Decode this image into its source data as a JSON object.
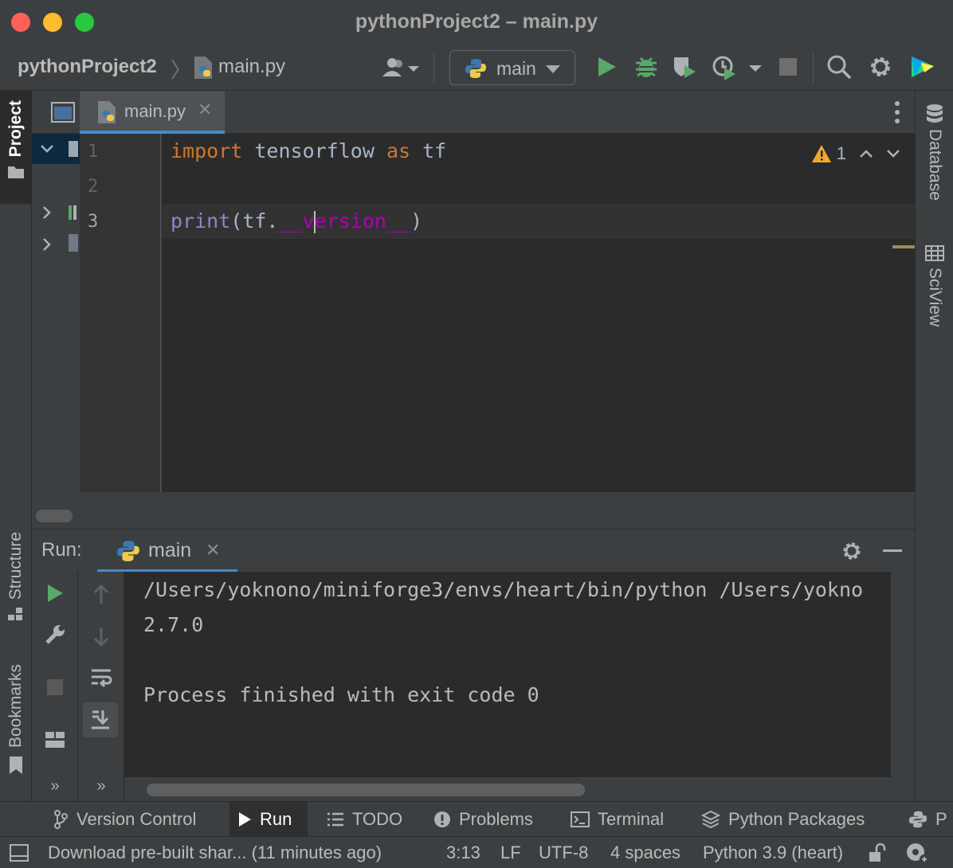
{
  "window": {
    "title": "pythonProject2 – main.py"
  },
  "breadcrumb": {
    "project": "pythonProject2",
    "file": "main.py"
  },
  "run_config": {
    "name": "main"
  },
  "editor": {
    "tab_label": "main.py",
    "line_numbers": [
      "1",
      "2",
      "3"
    ],
    "lines": {
      "l1_kw_import": "import",
      "l1_module": " tensorflow ",
      "l1_kw_as": "as",
      "l1_alias": " tf",
      "l3_print": "print",
      "l3_open": "(tf.",
      "l3_dunder_a": "__v",
      "l3_dunder_b": "ersion__",
      "l3_close": ")"
    },
    "inspection": {
      "warnings": "1"
    }
  },
  "left_tools": {
    "project": "Project",
    "structure": "Structure",
    "bookmarks": "Bookmarks"
  },
  "right_tools": {
    "database": "Database",
    "sciview": "SciView"
  },
  "run_panel": {
    "title": "Run:",
    "tab_label": "main",
    "output": [
      "/Users/yoknono/miniforge3/envs/heart/bin/python /Users/yokno",
      "2.7.0",
      "",
      "Process finished with exit code 0"
    ]
  },
  "bottom_tools": {
    "version_control": "Version Control",
    "run": "Run",
    "todo": "TODO",
    "problems": "Problems",
    "terminal": "Terminal",
    "python_packages": "Python Packages",
    "python_console": "P"
  },
  "status": {
    "message": "Download pre-built shar... (11 minutes ago)",
    "position": "3:13",
    "line_sep": "LF",
    "encoding": "UTF-8",
    "indent": "4 spaces",
    "interpreter": "Python 3.9 (heart)"
  },
  "colors": {
    "keyword": "#cc7832",
    "builtin": "#8888c6",
    "dunder": "#b200b2",
    "run_green": "#59a869",
    "accent_blue": "#4a88c7",
    "warning_yellow": "#f0a732"
  }
}
